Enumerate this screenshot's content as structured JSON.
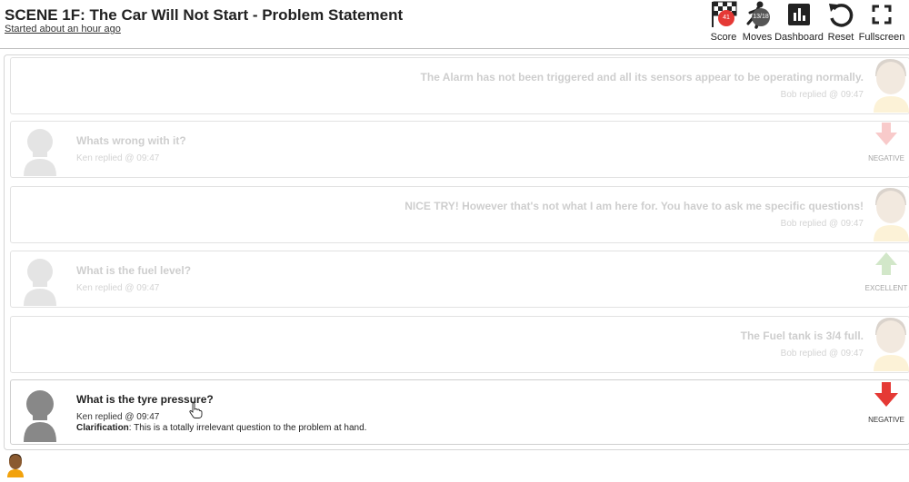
{
  "header": {
    "title": "SCENE 1F: The Car Will Not Start - Problem Statement",
    "subtitle": "Started about an hour ago"
  },
  "toolbar": {
    "score": {
      "label": "Score",
      "badge": "41",
      "icon": "checkered-flag-icon",
      "badge_color": "#e53935"
    },
    "moves": {
      "label": "Moves",
      "badge": "13/18",
      "icon": "running-person-icon",
      "badge_color": "#555555"
    },
    "dashboard": {
      "label": "Dashboard",
      "icon": "bar-chart-icon"
    },
    "reset": {
      "label": "Reset",
      "icon": "reset-icon"
    },
    "fullscreen": {
      "label": "Fullscreen",
      "icon": "fullscreen-icon"
    }
  },
  "messages": [
    {
      "speaker": "Bob",
      "side": "right",
      "text": "The Alarm has not been triggered and all its sensors appear to be operating normally.",
      "meta": "Bob replied @ 09:47",
      "faded": true
    },
    {
      "speaker": "Ken",
      "side": "left",
      "text": "Whats wrong with it?",
      "meta": "Ken replied @ 09:47",
      "faded": true,
      "feedback": {
        "label": "NEGATIVE",
        "direction": "down",
        "color": "#f08c8c"
      }
    },
    {
      "speaker": "Bob",
      "side": "right",
      "text": "NICE TRY! However that's not what I am here for. You have to ask me specific questions!",
      "meta": "Bob replied @ 09:47",
      "faded": true
    },
    {
      "speaker": "Ken",
      "side": "left",
      "text": "What is the fuel level?",
      "meta": "Ken replied @ 09:47",
      "faded": true,
      "feedback": {
        "label": "EXCELLENT",
        "direction": "up",
        "color": "#9ccc88"
      }
    },
    {
      "speaker": "Bob",
      "side": "right",
      "text": "The Fuel tank is 3/4 full.",
      "meta": "Bob replied @ 09:47",
      "faded": true
    },
    {
      "speaker": "Ken",
      "side": "left",
      "text": "What is the tyre pressure?",
      "meta": "Ken replied @ 09:47",
      "faded": false,
      "clarification_label": "Clarification",
      "clarification": ": This is a totally irrelevant question to the problem at hand.",
      "feedback": {
        "label": "NEGATIVE",
        "direction": "down",
        "color": "#e53935"
      }
    }
  ],
  "colors": {
    "accent_negative": "#e53935",
    "accent_positive": "#4caf50"
  }
}
